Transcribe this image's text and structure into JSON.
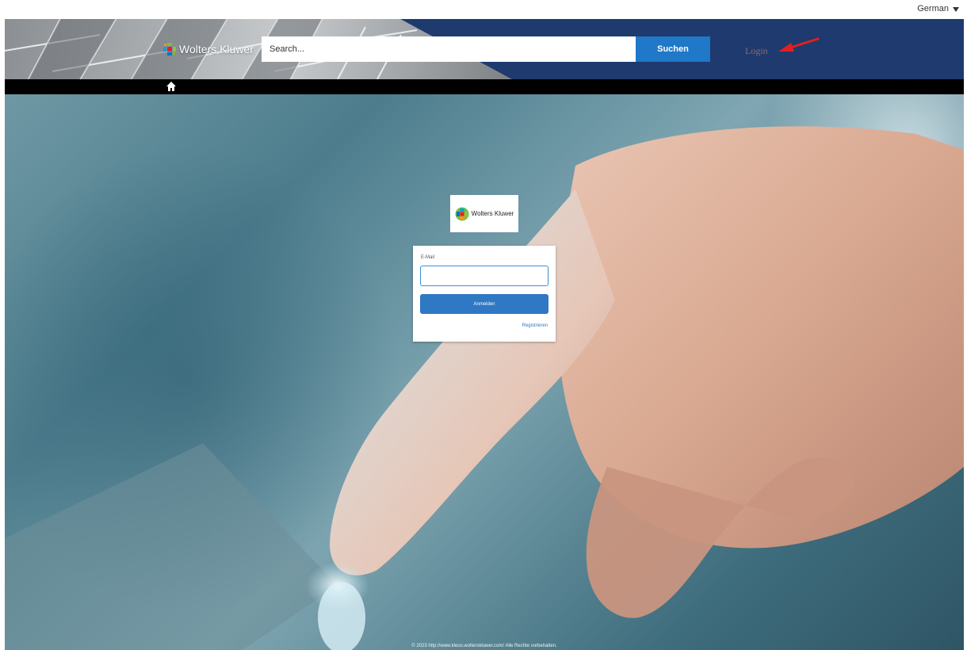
{
  "language": {
    "selected": "German"
  },
  "header": {
    "brand": "Wolters Kluwer",
    "search": {
      "placeholder": "Search...",
      "button_label": "Suchen"
    },
    "login_label": "Login"
  },
  "login_form": {
    "brand": "Wolters Kluwer",
    "email_label": "E-Mail",
    "email_value": "",
    "submit_label": "Anmelden",
    "register_label": "Registrieren"
  },
  "footer": {
    "copyright": "© 2023 http://www.kleos.wolterskluwer.com/ Alle Rechte vorbehalten."
  },
  "colors": {
    "header_bg": "#1f3a6e",
    "accent": "#1f78c8",
    "arrow": "#e02020"
  }
}
